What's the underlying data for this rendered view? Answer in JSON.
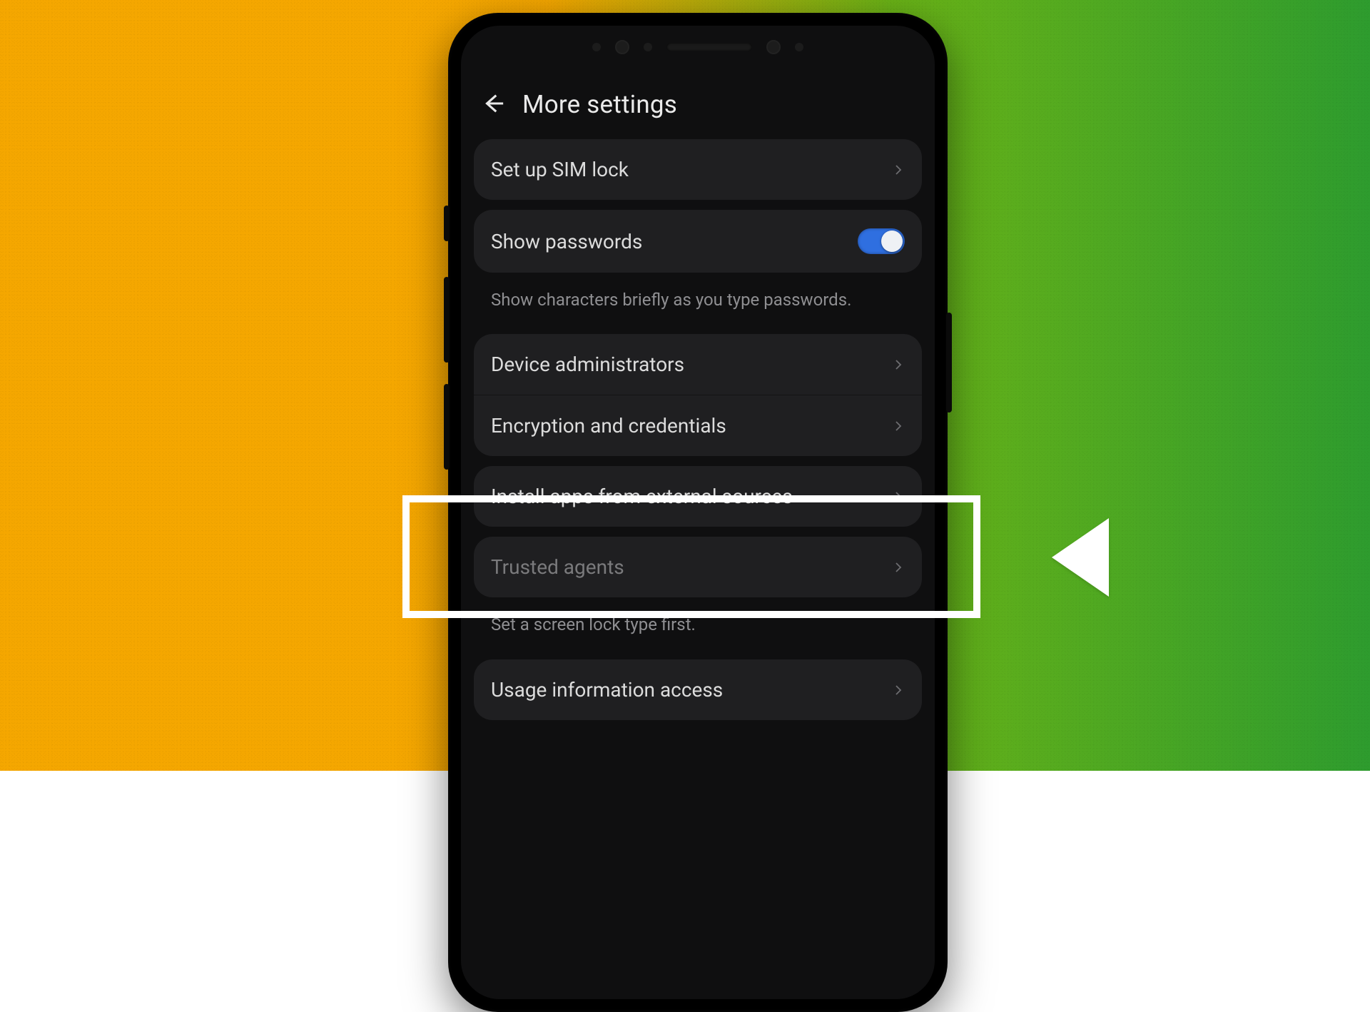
{
  "header": {
    "title": "More settings"
  },
  "items": {
    "sim_lock": {
      "label": "Set up SIM lock"
    },
    "show_passwords": {
      "label": "Show passwords",
      "enabled": true
    },
    "show_passwords_help": "Show characters briefly as you type passwords.",
    "device_admins": {
      "label": "Device administrators"
    },
    "encryption": {
      "label": "Encryption and credentials"
    },
    "install_external": {
      "label": "Install apps from external sources"
    },
    "trusted_agents": {
      "label": "Trusted agents"
    },
    "trusted_agents_help": "Set a screen lock type first.",
    "usage_info": {
      "label": "Usage information access"
    }
  },
  "annotation": {
    "highlight_target": "install_external"
  }
}
